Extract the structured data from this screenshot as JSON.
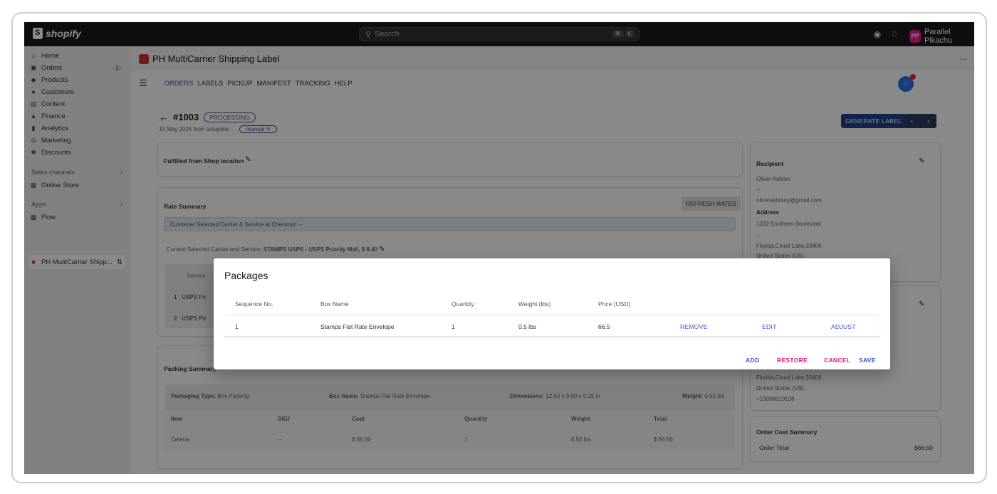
{
  "topbar": {
    "logo": "shopify",
    "search_placeholder": "Search",
    "search_kbd": [
      "⌘",
      "K"
    ],
    "store_initials": "PP",
    "store_name": "Parallel Pikachu"
  },
  "sidebar": {
    "items": [
      {
        "label": "Home",
        "icon": "home-icon"
      },
      {
        "label": "Orders",
        "icon": "orders-icon",
        "badge": "1"
      },
      {
        "label": "Products",
        "icon": "tag-icon"
      },
      {
        "label": "Customers",
        "icon": "person-icon"
      },
      {
        "label": "Content",
        "icon": "content-icon"
      },
      {
        "label": "Finance",
        "icon": "bank-icon"
      },
      {
        "label": "Analytics",
        "icon": "bar-chart-icon"
      },
      {
        "label": "Marketing",
        "icon": "target-icon"
      },
      {
        "label": "Discounts",
        "icon": "discount-icon"
      }
    ],
    "sales_channels_label": "Sales channels",
    "online_store": "Online Store",
    "apps_label": "Apps",
    "flow": "Flow",
    "pinned_app": "PH MultiCarrier Shipp..."
  },
  "app": {
    "title": "PH MultiCarrier Shipping Label",
    "more": "...",
    "nav": [
      "ORDERS",
      "LABELS",
      "PICKUP",
      "MANIFEST",
      "TRACKING",
      "HELP"
    ]
  },
  "order": {
    "number": "#1003",
    "status": "PROCESSING",
    "sub": "15 May 2025 from setupdoc",
    "manual": "manual",
    "generate_label": "GENERATE LABEL",
    "fulfilled_from": "Fulfilled from Shop location",
    "rate_summary": "Rate Summary",
    "refresh_rates": "REFRESH RATES",
    "customer_selected": "Customer Selected Carrier & Service at Checkout: --",
    "current_selected_prefix": "Current Selected Carrier and Service: ",
    "current_selected_value": "STAMPS USPS - USPS Priority Mail, $ 8.40",
    "service_header": "Service",
    "service_rows": [
      {
        "n": "1",
        "label": "USPS Pri"
      },
      {
        "n": "2",
        "label": "USPS Pri"
      }
    ],
    "packing_summary": "Packing Summary",
    "packaging_type_label": "Packaging Type:",
    "packaging_type_value": "Box Packing",
    "box_name_label": "Box Name:",
    "box_name_value": "Stamps Flat Rate Envelope",
    "dimensions_label": "Dimensions:",
    "dimensions_value": "12.50 x 9.50 x 0.25 in",
    "weight_label": "Weight:",
    "weight_value": "0.50 lbs",
    "items_headers": [
      "Item",
      "SKU",
      "Cost",
      "Quantity",
      "Weight",
      "Total"
    ],
    "items_rows": [
      [
        "Celena",
        "--",
        "$ 66.50",
        "1",
        "0.50 lbs",
        "$ 66.50"
      ]
    ]
  },
  "recipient": {
    "title": "Recipient",
    "name": "Oliver Ashton",
    "dash": "--",
    "email": "oliverashtony@gmail.com",
    "address_label": "Address",
    "street": "1332 Southern Boulevard",
    "dash2": "--",
    "city": "Florida,Cloud Lake,33406",
    "country": "United States (US)"
  },
  "shipper": {
    "city": "Florida,Cloud Lake,33406",
    "country": "United States (US)",
    "phone": "+19098619138"
  },
  "cost_summary": {
    "title": "Order Cost Summary",
    "total_label": "Order Total",
    "total_value": "$66.50"
  },
  "modal": {
    "title": "Packages",
    "headers": [
      "Sequence No.",
      "Box Name",
      "Quantity",
      "Weight (lbs)",
      "Price (USD)"
    ],
    "row": {
      "seq": "1",
      "box": "Stamps Flat Rate Envelope",
      "qty": "1",
      "weight": "0.5 lbs",
      "price": "66.5"
    },
    "row_actions": [
      "REMOVE",
      "EDIT",
      "ADJUST"
    ],
    "footer_actions": {
      "add": "ADD",
      "restore": "RESTORE",
      "cancel": "CANCEL",
      "save": "SAVE"
    },
    "colors": {
      "accent": "#3f51b5",
      "danger": "#e0197d"
    }
  }
}
